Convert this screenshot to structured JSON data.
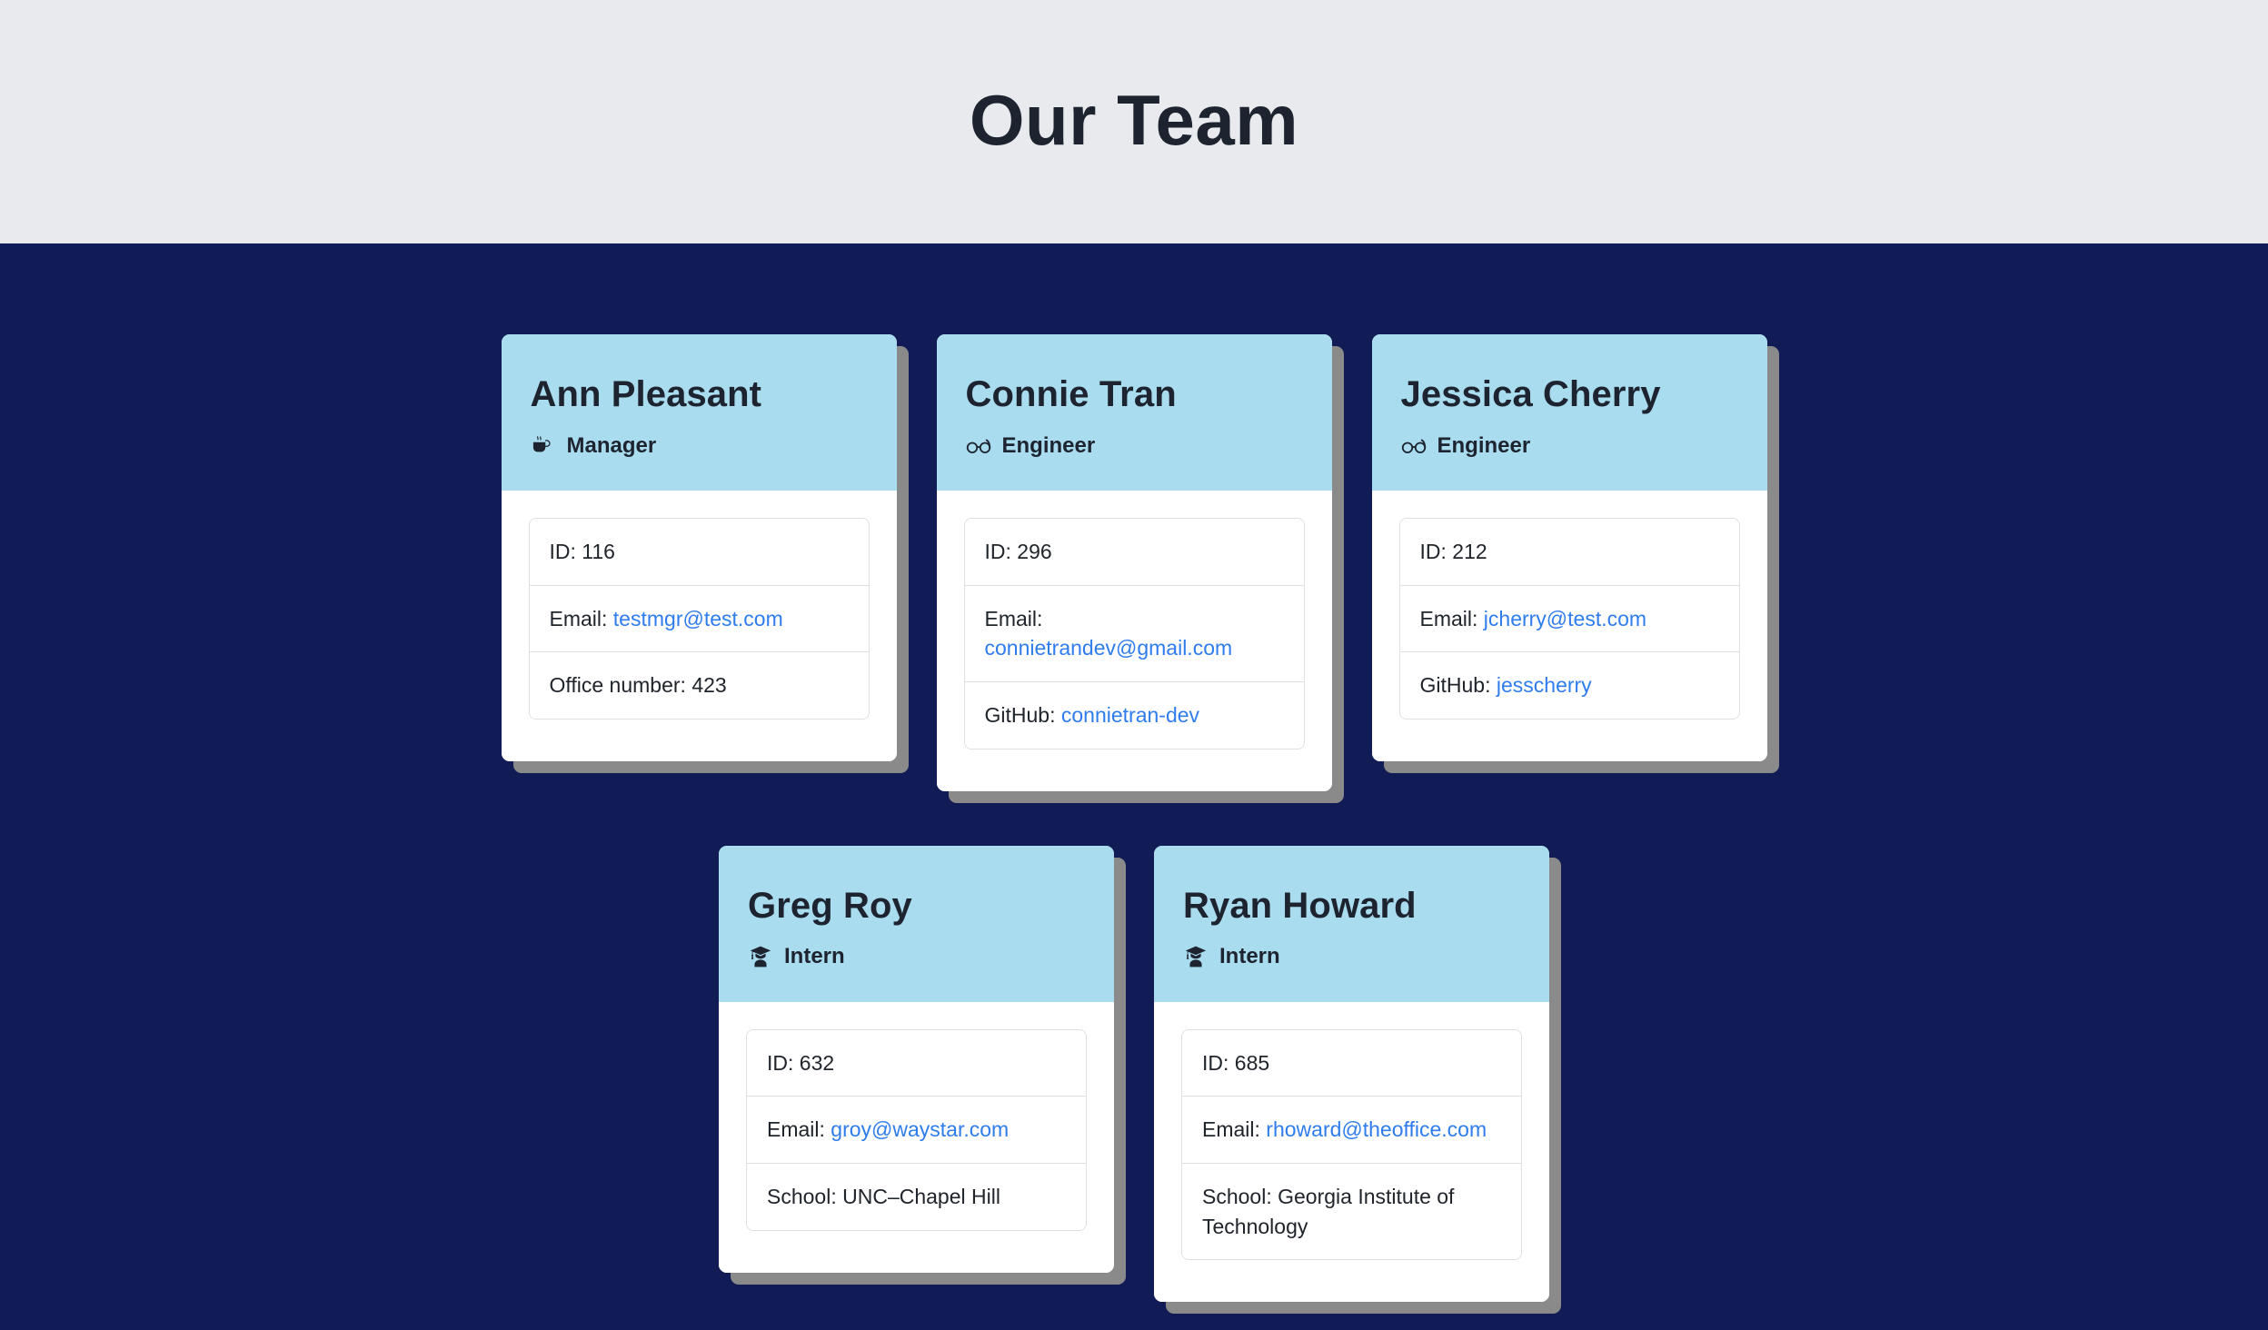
{
  "header": {
    "title": "Our Team",
    "background_color": "#e9eaee",
    "text_color": "#1d2430"
  },
  "theme": {
    "page_background": "#111b56",
    "card_header_background": "#a9dcee",
    "card_body_background": "#ffffff",
    "shadow_color": "#8a8a8a",
    "link_color": "#2f7ced",
    "border_color": "#dddfe2"
  },
  "rows": [
    {
      "cards": [
        {
          "name": "Ann Pleasant",
          "role": "Manager",
          "role_icon": "coffee-cup-icon",
          "items": [
            {
              "label": "ID: ",
              "value": "116",
              "link": false
            },
            {
              "label": "Email: ",
              "value": "testmgr@test.com",
              "link": true
            },
            {
              "label": "Office number: ",
              "value": "423",
              "link": false
            }
          ]
        },
        {
          "name": "Connie Tran",
          "role": "Engineer",
          "role_icon": "glasses-icon",
          "items": [
            {
              "label": "ID: ",
              "value": "296",
              "link": false
            },
            {
              "label": "Email: ",
              "value": "connietrandev@gmail.com",
              "link": true
            },
            {
              "label": "GitHub: ",
              "value": "connietran-dev",
              "link": true
            }
          ]
        },
        {
          "name": "Jessica Cherry",
          "role": "Engineer",
          "role_icon": "glasses-icon",
          "items": [
            {
              "label": "ID: ",
              "value": "212",
              "link": false
            },
            {
              "label": "Email: ",
              "value": "jcherry@test.com",
              "link": true
            },
            {
              "label": "GitHub: ",
              "value": "jesscherry",
              "link": true
            }
          ]
        }
      ]
    },
    {
      "cards": [
        {
          "name": "Greg Roy",
          "role": "Intern",
          "role_icon": "graduate-icon",
          "items": [
            {
              "label": "ID: ",
              "value": "632",
              "link": false
            },
            {
              "label": "Email: ",
              "value": "groy@waystar.com",
              "link": true
            },
            {
              "label": "School: ",
              "value": "UNC–Chapel Hill",
              "link": false
            }
          ]
        },
        {
          "name": "Ryan Howard",
          "role": "Intern",
          "role_icon": "graduate-icon",
          "items": [
            {
              "label": "ID: ",
              "value": "685",
              "link": false
            },
            {
              "label": "Email: ",
              "value": "rhoward@theoffice.com",
              "link": true
            },
            {
              "label": "School: ",
              "value": "Georgia Institute of Technology",
              "link": false
            }
          ]
        }
      ]
    }
  ]
}
